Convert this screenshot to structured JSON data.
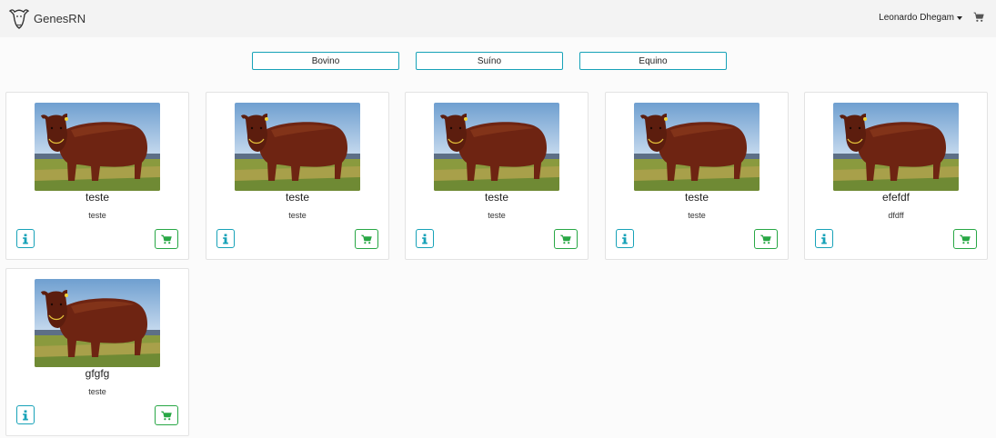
{
  "navbar": {
    "brand": "GenesRN",
    "user": "Leonardo Dhegam",
    "cart_icon": "shopping-cart-icon",
    "logo_icon": "bull-head-logo"
  },
  "species": [
    {
      "label": "Bovino"
    },
    {
      "label": "Suíno"
    },
    {
      "label": "Equino"
    }
  ],
  "products": [
    {
      "title": "teste",
      "subtitle": "teste"
    },
    {
      "title": "teste",
      "subtitle": "teste"
    },
    {
      "title": "teste",
      "subtitle": "teste"
    },
    {
      "title": "teste",
      "subtitle": "teste"
    },
    {
      "title": "efefdf",
      "subtitle": "dfdff"
    },
    {
      "title": "gfgfg",
      "subtitle": "teste"
    }
  ],
  "colors": {
    "info": "#17a2b8",
    "success": "#28a745",
    "navbar_bg": "#f3f3f3"
  }
}
